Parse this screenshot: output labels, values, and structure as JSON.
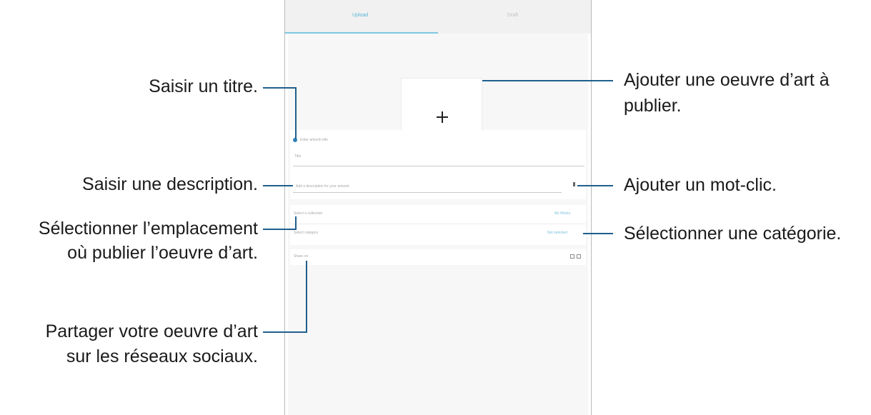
{
  "tabs": {
    "upload_label": "Upload",
    "draft_label": "Draft"
  },
  "screen": {
    "title_hint": "Enter artwork title",
    "title_field": "Title",
    "description_hint": "Add a description for your artwork",
    "location_label": "Select a collection",
    "location_value": "My Works",
    "category_label": "Select category",
    "category_value": "Not selected",
    "share_label": "Share on"
  },
  "callouts": {
    "title": "Saisir un titre.",
    "description": "Saisir une description.",
    "location_line1": "Sélectionner l’emplacement",
    "location_line2": "où publier l’oeuvre d’art.",
    "share_line1": "Partager votre oeuvre d’art",
    "share_line2": "sur les réseaux sociaux.",
    "add_art_line1": "Ajouter une oeuvre d’art à",
    "add_art_line2": "publier.",
    "tag": "Ajouter un mot-clic.",
    "category": "Sélectionner une catégorie."
  },
  "colors": {
    "callout_line": "#1f5f8e",
    "accent": "#5bb6d6"
  }
}
